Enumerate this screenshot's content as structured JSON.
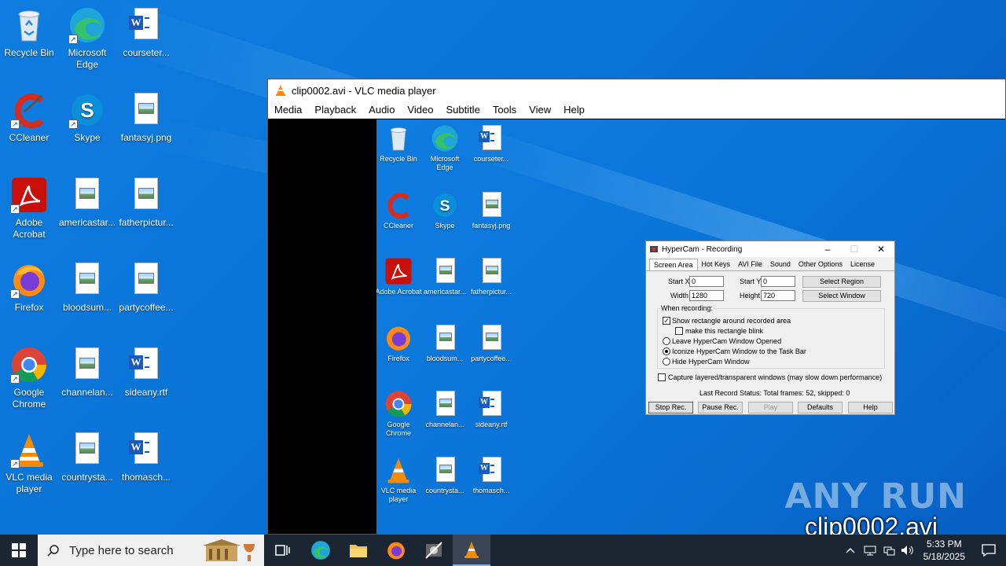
{
  "desktop": {
    "icons": [
      {
        "label": "Recycle Bin",
        "type": "recycle"
      },
      {
        "label": "Microsoft Edge",
        "type": "edge"
      },
      {
        "label": "courseter...",
        "type": "word"
      },
      {
        "label": "CCleaner",
        "type": "ccleaner"
      },
      {
        "label": "Skype",
        "type": "skype"
      },
      {
        "label": "fantasyj.png",
        "type": "image"
      },
      {
        "label": "Adobe Acrobat",
        "type": "acrobat"
      },
      {
        "label": "americastar...",
        "type": "image"
      },
      {
        "label": "fatherpictur...",
        "type": "image"
      },
      {
        "label": "Firefox",
        "type": "firefox"
      },
      {
        "label": "bloodsum...",
        "type": "image"
      },
      {
        "label": "partycoffee...",
        "type": "image"
      },
      {
        "label": "Google Chrome",
        "type": "chrome"
      },
      {
        "label": "channelan...",
        "type": "image"
      },
      {
        "label": "sideany.rtf",
        "type": "word"
      },
      {
        "label": "VLC media player",
        "type": "vlc"
      },
      {
        "label": "countrysta...",
        "type": "image"
      },
      {
        "label": "thomasch...",
        "type": "word"
      }
    ]
  },
  "vlc": {
    "title": "clip0002.avi - VLC media player",
    "menu": [
      "Media",
      "Playback",
      "Audio",
      "Video",
      "Subtitle",
      "Tools",
      "View",
      "Help"
    ],
    "overlay_filename": "clip0002.avi"
  },
  "hypercam": {
    "title": "HyperCam - Recording",
    "tabs": [
      "Screen Area",
      "Hot Keys",
      "AVI File",
      "Sound",
      "Other Options",
      "License"
    ],
    "start_x_label": "Start X",
    "start_x": "0",
    "start_y_label": "Start Y",
    "start_y": "0",
    "width_label": "Width",
    "width": "1280",
    "height_label": "Height",
    "height": "720",
    "select_region": "Select Region",
    "select_window": "Select Window",
    "when_recording": "When recording:",
    "opt_show_rect": "Show rectangle around recorded area",
    "opt_blink": "make this rectangle blink",
    "opt_leave": "Leave HyperCam Window Opened",
    "opt_iconize": "Iconize HyperCam Window to the Task Bar",
    "opt_hide": "Hide HyperCam Window",
    "opt_layered": "Capture layered/transparent windows (may slow down performance)",
    "status": "Last Record Status: Total frames: 52, skipped: 0",
    "buttons": {
      "stop": "Stop Rec.",
      "pause": "Pause Rec.",
      "play": "Play",
      "defaults": "Defaults",
      "help": "Help"
    }
  },
  "taskbar": {
    "search_placeholder": "Type here to search",
    "time": "5:33 PM",
    "date": "5/18/2025"
  },
  "watermark": "ANY RUN"
}
